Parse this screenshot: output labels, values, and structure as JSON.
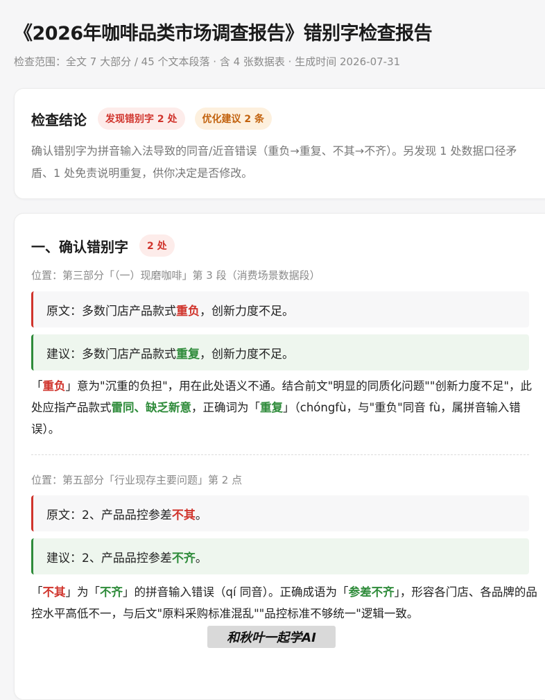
{
  "header": {
    "title": "《2026年咖啡品类市场调查报告》错别字检查报告",
    "meta": "检查范围：全文 7 大部分 / 45 个文本段落 · 含 4 张数据表 · 生成时间 2026-07-31"
  },
  "summary": {
    "heading": "检查结论",
    "badge_errors": "发现错别字 2 处",
    "badge_suggestions": "优化建议 2 条",
    "text": "确认错别字为拼音输入法导致的同音/近音错误（重负→重复、不其→不齐）。另发现 1 处数据口径矛盾、1 处免责说明重复，供你决定是否修改。"
  },
  "section": {
    "heading": "一、确认错别字",
    "badge": "2 处",
    "items": [
      {
        "location": "位置：第三部分「（一）现磨咖啡」第 3 段（消费场景数据段）",
        "orig_prefix": "原文：多数门店产品款式",
        "orig_word": "重负",
        "orig_suffix": "，创新力度不足。",
        "sugg_prefix": "建议：多数门店产品款式",
        "sugg_word": "重复",
        "sugg_suffix": "，创新力度不足。",
        "exp_1": "「",
        "exp_2": "重负",
        "exp_3": "」意为\"沉重的负担\"，用在此处语义不通。结合前文\"明显的同质化问题\"\"创新力度不足\"，此处应指产品款式",
        "exp_4": "雷同、缺乏新意",
        "exp_5": "，正确词为「",
        "exp_6": "重复",
        "exp_7": "」（chóngfù，与\"重负\"同音 fù，属拼音输入错误）。"
      },
      {
        "location": "位置：第五部分「行业现存主要问题」第 2 点",
        "orig_prefix": "原文：2、产品品控参差",
        "orig_word": "不其",
        "orig_suffix": "。",
        "sugg_prefix": "建议：2、产品品控参差",
        "sugg_word": "不齐",
        "sugg_suffix": "。",
        "exp_1": "「",
        "exp_2": "不其",
        "exp_3": "」为「",
        "exp_4": "不齐",
        "exp_5": "」的拼音输入错误（qí 同音）。正确成语为「",
        "exp_6": "参差不齐",
        "exp_7": "」，形容各门店、各品牌的品控水平高低不一，与后文\"原料采购标准混乱\"\"品控标准不够统一\"逻辑一致。"
      }
    ]
  },
  "watermark": "和秋叶一起学AI"
}
